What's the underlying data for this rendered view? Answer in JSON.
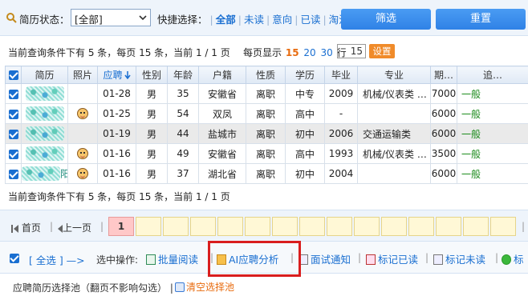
{
  "filter": {
    "status_label": "简历状态：",
    "status_value": "[全部]",
    "quick_label": "快捷选择：",
    "quick_options": [
      "全部",
      "未读",
      "意向",
      "已读",
      "淘汰"
    ],
    "filter_button": "筛选",
    "reset_button": "重置"
  },
  "summary_text": "当前查询条件下有 5 条，每页 15 条，当前 1 / 1 页",
  "perpage": {
    "label": "每页显示",
    "options": [
      "15",
      "20",
      "30"
    ],
    "suffix": "行",
    "input_value": "15",
    "set_button": "设置"
  },
  "table": {
    "headers": [
      "简历",
      "照片",
      "应聘",
      "性别",
      "年龄",
      "户籍",
      "性质",
      "学历",
      "毕业",
      "专业",
      "期…",
      "追…"
    ],
    "sort_icon": "arrow-down-icon",
    "rows": [
      {
        "name": "",
        "photo": false,
        "date": "01-28",
        "gender": "男",
        "age": "35",
        "hukou": "安徽省",
        "nature": "离职",
        "edu": "中专",
        "grad": "2009",
        "major": "机械/仪表类 …",
        "salary": "7000",
        "follow": "一般"
      },
      {
        "name": "",
        "photo": true,
        "date": "01-25",
        "gender": "男",
        "age": "54",
        "hukou": "双凤",
        "nature": "离职",
        "edu": "高中",
        "grad": "-",
        "major": "",
        "salary": "6000",
        "follow": "一般"
      },
      {
        "name": "",
        "photo": false,
        "date": "01-19",
        "gender": "男",
        "age": "44",
        "hukou": "盐城市",
        "nature": "离职",
        "edu": "初中",
        "grad": "2006",
        "major": "交通运输类",
        "salary": "6000",
        "follow": "一般"
      },
      {
        "name": "",
        "photo": true,
        "date": "01-16",
        "gender": "男",
        "age": "49",
        "hukou": "安徽省",
        "nature": "离职",
        "edu": "高中",
        "grad": "1993",
        "major": "机械/仪表类 …",
        "salary": "3500",
        "follow": "一般"
      },
      {
        "name": "阳",
        "photo": true,
        "date": "01-16",
        "gender": "男",
        "age": "37",
        "hukou": "湖北省",
        "nature": "离职",
        "edu": "初中",
        "grad": "2004",
        "major": "",
        "salary": "6000",
        "follow": "一般"
      }
    ]
  },
  "pager": {
    "first": "首页",
    "prev": "上一页",
    "current_page": "1"
  },
  "actions": {
    "select_all": "[ 全选 ] —>",
    "label": "选中操作:",
    "items": [
      "批量阅读",
      "AI应聘分析",
      "面试通知",
      "标记已读",
      "标记未读",
      "标"
    ]
  },
  "pool": {
    "label": "应聘简历选择池（翻页不影响勾选）",
    "clear": "清空选择池"
  },
  "colors": {
    "accent": "#1a6fd1",
    "highlight": "#d91e1e",
    "orange": "#e86b0e"
  }
}
